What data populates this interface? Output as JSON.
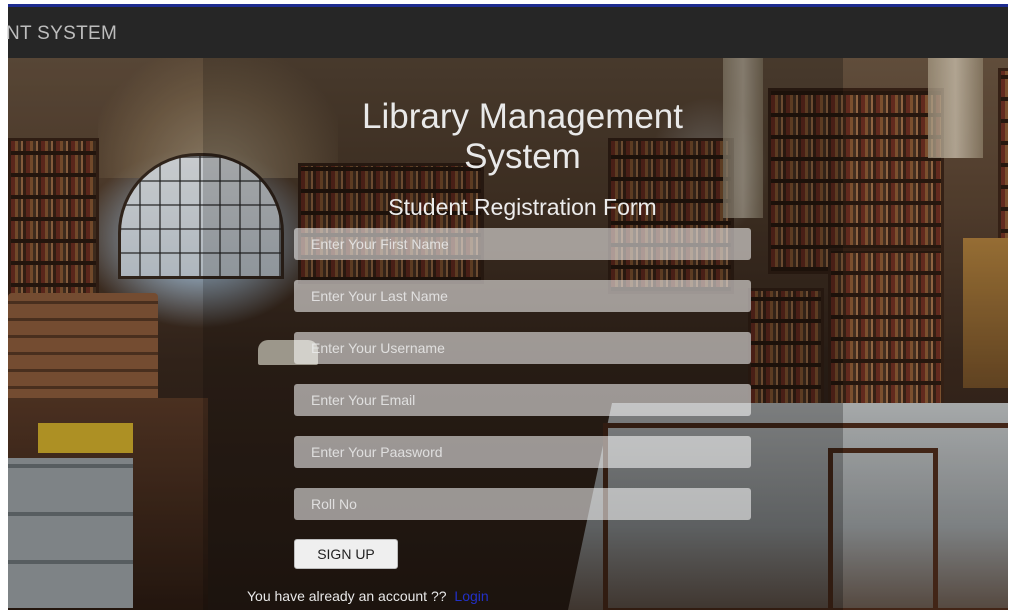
{
  "navbar": {
    "brand": "NT SYSTEM"
  },
  "form": {
    "title": "Library Management System",
    "subtitle": "Student Registration Form",
    "fields": [
      {
        "placeholder": "Enter Your First Name"
      },
      {
        "placeholder": "Enter Your Last Name"
      },
      {
        "placeholder": "Enter Your Username"
      },
      {
        "placeholder": "Enter Your Email"
      },
      {
        "placeholder": "Enter Your Paasword"
      },
      {
        "placeholder": "Roll No"
      }
    ],
    "signup_label": "SIGN UP",
    "account_text": "You have already an account ??",
    "login_label": "Login"
  },
  "colors": {
    "navbar_bg": "#262626",
    "link": "#2230c8",
    "top_line": "#1d2b8f"
  }
}
